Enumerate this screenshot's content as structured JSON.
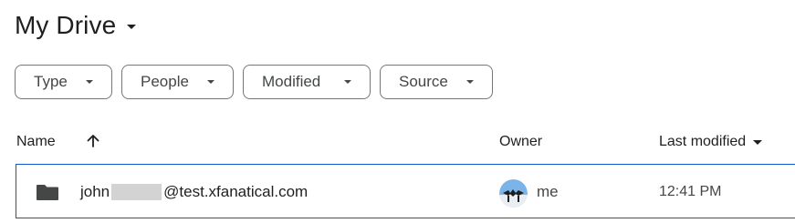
{
  "header": {
    "title": "My Drive"
  },
  "filters": [
    {
      "label": "Type"
    },
    {
      "label": "People"
    },
    {
      "label": "Modified"
    },
    {
      "label": "Source"
    }
  ],
  "columns": {
    "name": "Name",
    "owner": "Owner",
    "last_modified": "Last modified"
  },
  "files": [
    {
      "name_prefix": "john",
      "name_suffix": "@test.xfanatical.com",
      "owner": "me",
      "modified": "12:41 PM",
      "icon": "folder-icon"
    }
  ],
  "colors": {
    "selection_border": "#0b57d0",
    "chip_border": "#747775",
    "text_primary": "#1f1f1f",
    "text_secondary": "#444746"
  }
}
